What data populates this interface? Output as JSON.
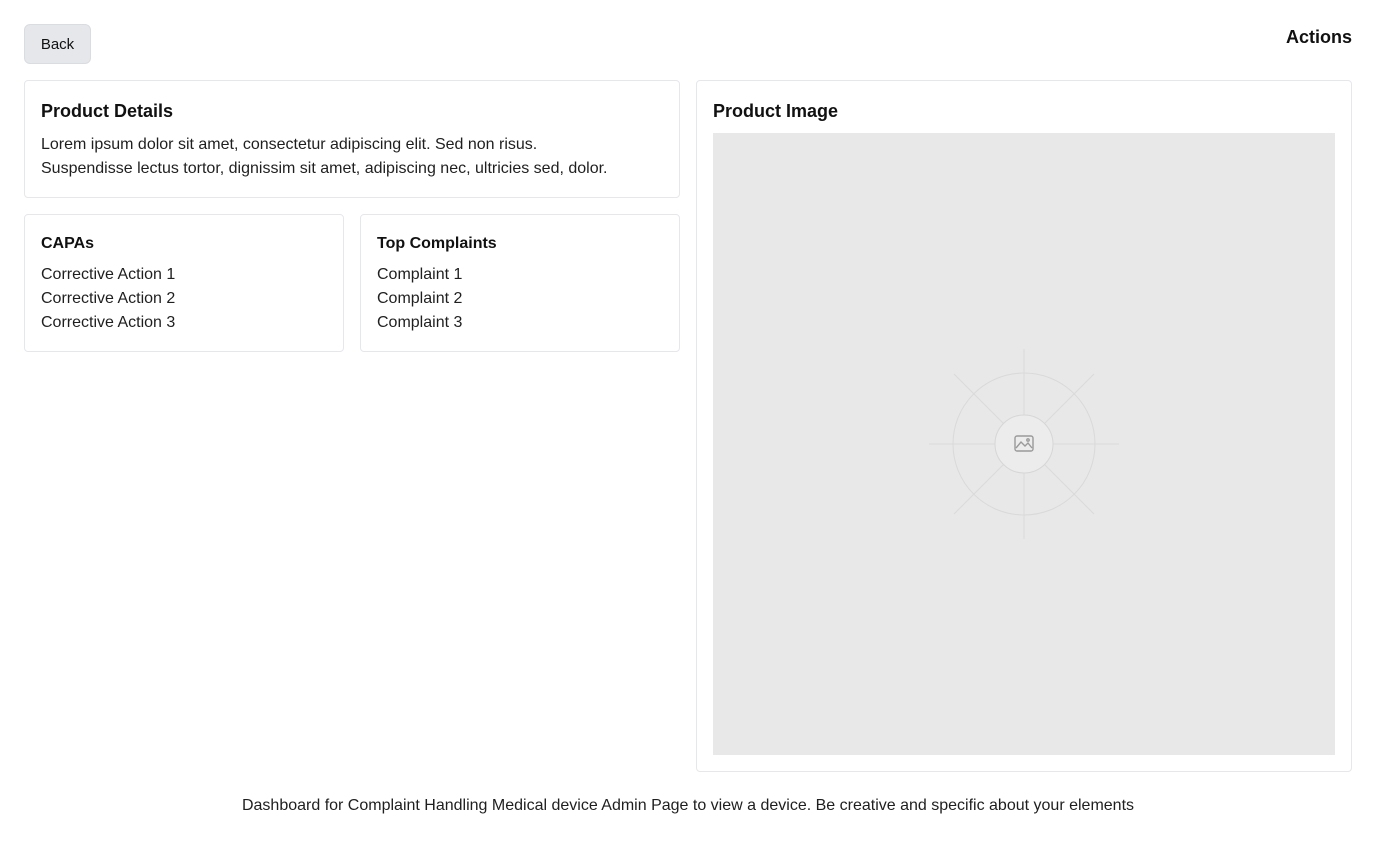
{
  "header": {
    "back_label": "Back",
    "actions_title": "Actions"
  },
  "product_details": {
    "title": "Product Details",
    "description_line1": "Lorem ipsum dolor sit amet, consectetur adipiscing elit. Sed non risus.",
    "description_line2": "Suspendisse lectus tortor, dignissim sit amet, adipiscing nec, ultricies sed, dolor."
  },
  "capas": {
    "title": "CAPAs",
    "items": [
      "Corrective Action 1",
      "Corrective Action 2",
      "Corrective Action 3"
    ]
  },
  "complaints": {
    "title": "Top Complaints",
    "items": [
      "Complaint 1",
      "Complaint 2",
      "Complaint 3"
    ]
  },
  "product_image": {
    "title": "Product Image",
    "icon": "image-icon"
  },
  "footer": {
    "text": "Dashboard for Complaint Handling Medical device Admin Page to view a device. Be creative and specific about your elements"
  }
}
